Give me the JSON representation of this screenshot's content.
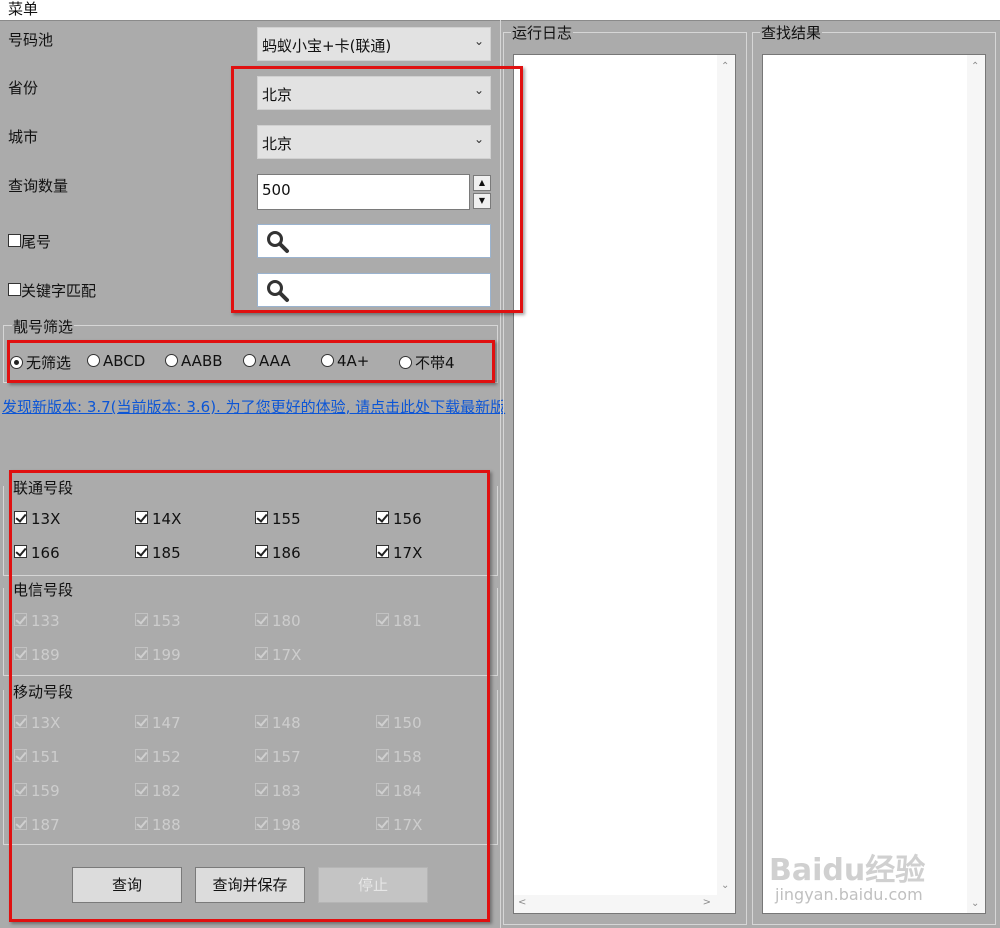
{
  "menu": {
    "label": "菜单"
  },
  "form": {
    "pool_label": "号码池",
    "pool_value": "蚂蚁小宝+卡(联通)",
    "province_label": "省份",
    "province_value": "北京",
    "city_label": "城市",
    "city_value": "北京",
    "qty_label": "查询数量",
    "qty_value": "500",
    "tail_label": "尾号",
    "keyword_label": "关键字匹配"
  },
  "filter": {
    "title": "靓号筛选",
    "options": [
      "无筛选",
      "ABCD",
      "AABB",
      "AAA",
      "4A+",
      "不带4"
    ],
    "selected": "无筛选"
  },
  "update_link": "发现新版本: 3.7(当前版本: 3.6). 为了您更好的体验, 请点击此处下载最新版",
  "unicom": {
    "title": "联通号段",
    "items": [
      "13X",
      "14X",
      "155",
      "156",
      "166",
      "185",
      "186",
      "17X"
    ]
  },
  "telecom": {
    "title": "电信号段",
    "items": [
      "133",
      "153",
      "180",
      "181",
      "189",
      "199",
      "17X"
    ]
  },
  "mobile": {
    "title": "移动号段",
    "items": [
      "13X",
      "147",
      "148",
      "150",
      "151",
      "152",
      "157",
      "158",
      "159",
      "182",
      "183",
      "184",
      "187",
      "188",
      "198",
      "17X"
    ]
  },
  "buttons": {
    "query": "查询",
    "query_save": "查询并保存",
    "stop": "停止"
  },
  "panels": {
    "log_title": "运行日志",
    "result_title": "查找结果"
  },
  "watermark": {
    "brand": "Baidu经验",
    "url": "jingyan.baidu.com"
  },
  "colors": {
    "highlight": "#e01010",
    "link": "#0b55d6",
    "background": "#ababab"
  }
}
